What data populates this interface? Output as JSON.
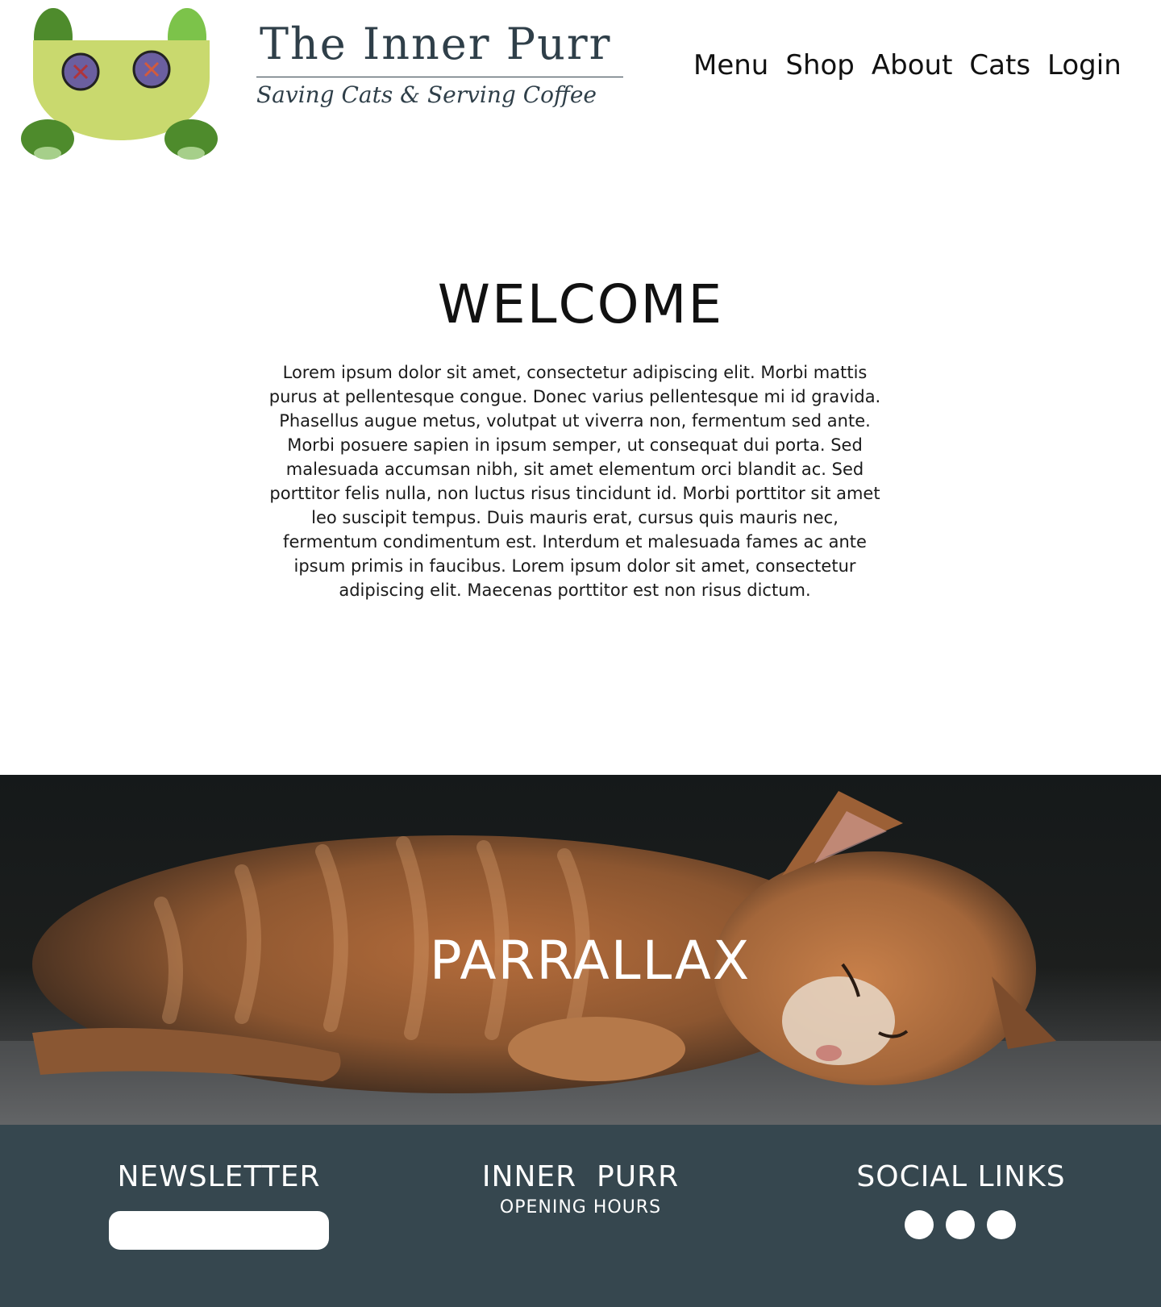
{
  "header": {
    "brand_title": "The Inner Purr",
    "brand_tagline": "Saving Cats & Serving Coffee",
    "logo_icon": "cat-face-logo-icon",
    "nav": [
      "Menu",
      "Shop",
      "About",
      "Cats",
      "Login"
    ]
  },
  "welcome": {
    "title": "WELCOME",
    "body": "Lorem ipsum dolor sit amet, consectetur adipiscing elit. Morbi mattis purus at pellentesque congue. Donec varius pellentesque mi id gravida. Phasellus augue metus, volutpat ut viverra non, fermentum sed ante. Morbi posuere sapien in ipsum semper, ut consequat dui porta. Sed malesuada accumsan nibh, sit amet elementum orci blandit ac. Sed porttitor felis nulla, non luctus risus tincidunt id. Morbi porttitor sit amet leo suscipit tempus. Duis mauris erat, cursus quis mauris nec, fermentum condimentum est. Interdum et malesuada fames ac ante ipsum primis in faucibus. Lorem ipsum dolor sit amet, consectetur adipiscing elit. Maecenas porttitor est non risus dictum."
  },
  "parallax": {
    "title": "PARRALLAX",
    "image": "sleeping-kitten-photo"
  },
  "footer": {
    "newsletter_title": "NEWSLETTER",
    "hours_title": "INNER  PURR",
    "hours_subtitle": "OPENING HOURS",
    "social_title": "SOCIAL LINKS",
    "social_icons": [
      "social-link-icon",
      "social-link-icon",
      "social-link-icon"
    ]
  },
  "colors": {
    "footer_bg": "#36474f",
    "brand_text": "#2f3f49",
    "logo_face": "#c9d96e",
    "logo_ear_light": "#7cc34a",
    "logo_ear_dark": "#4e8b2c",
    "logo_eye": "#6b5fa0"
  }
}
